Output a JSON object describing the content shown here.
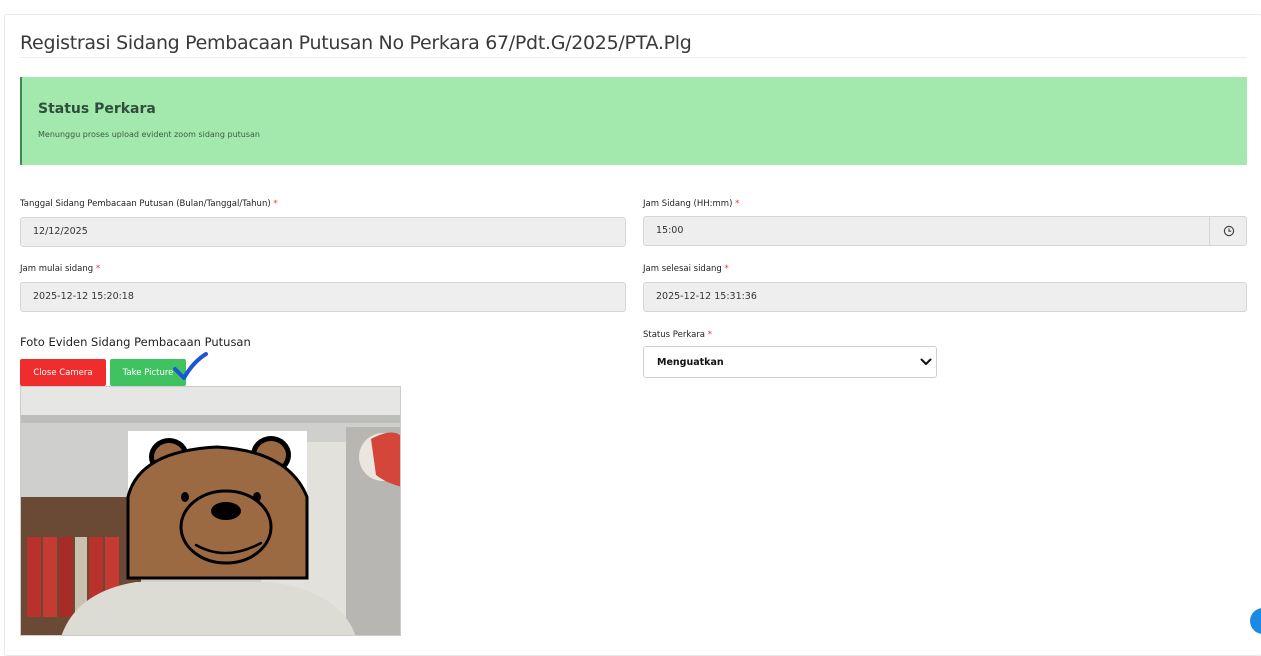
{
  "page": {
    "title": "Registrasi Sidang Pembacaan Putusan No Perkara 67/Pdt.G/2025/PTA.Plg"
  },
  "status_panel": {
    "title": "Status Perkara",
    "description": "Menunggu proses upload evident zoom sidang putusan"
  },
  "form": {
    "tanggal": {
      "label": "Tanggal Sidang Pembacaan Putusan (Bulan/Tanggal/Tahun)",
      "required_mark": "*",
      "value": "12/12/2025"
    },
    "jam_sidang": {
      "label": "Jam Sidang (HH:mm)",
      "required_mark": "*",
      "value": "15:00"
    },
    "jam_mulai": {
      "label": "Jam mulai sidang",
      "required_mark": "*",
      "value": "2025-12-12 15:20:18"
    },
    "jam_selesai": {
      "label": "Jam selesai sidang",
      "required_mark": "*",
      "value": "2025-12-12 15:31:36"
    },
    "status_perkara": {
      "label": "Status Perkara",
      "required_mark": "*",
      "selected": "Menguatkan"
    }
  },
  "camera": {
    "heading": "Foto Eviden Sidang Pembacaan Putusan",
    "close_label": "Close Camera",
    "take_label": "Take Picture"
  },
  "colors": {
    "status_bg": "#a3e9ad",
    "close_btn": "#f02d2d",
    "take_btn": "#3fc25f",
    "required": "#e53935"
  },
  "icons": {
    "time": "clock-icon",
    "select": "chevron-down-icon",
    "annotation": "checkmark-icon"
  }
}
